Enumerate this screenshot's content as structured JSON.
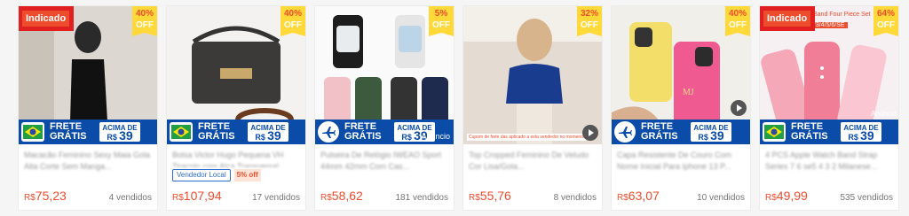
{
  "colors": {
    "accent": "#ee4d2d",
    "frete_bg": "#0a4ca8",
    "discount_bg": "#ffd839"
  },
  "promo": {
    "line1": "FRETE",
    "line2": "GRÁTIS",
    "box_top": "ACIMA DE",
    "box_currency": "R$",
    "box_value": "39"
  },
  "products": [
    {
      "discount": "40%",
      "off": "OFF",
      "badge": "Indicado",
      "title": "Macacão Feminino Sexy Maia Gola Alta Corte Sem Manga...",
      "price_symbol": "R$",
      "price": "75,23",
      "sold": "4 vendidos",
      "icon": "brazil-flag-icon"
    },
    {
      "discount": "40%",
      "off": "OFF",
      "title": "Bolsa Victor Hugo Pequena VH Tiracolo com Alça Transversal...",
      "tag_local": "Vendedor Local",
      "tag_off": "5% off",
      "price_symbol": "R$",
      "price": "107,94",
      "sold": "17 vendidos",
      "icon": "brazil-flag-icon"
    },
    {
      "discount": "5%",
      "off": "OFF",
      "title": "Pulseira De Relógio IWEAO Sport 44mm 42mm Com Cas...",
      "overlay": "Anúncio",
      "price_symbol": "R$",
      "price": "58,62",
      "sold": "181 vendidos",
      "icon": "airplane-icon"
    },
    {
      "discount": "32%",
      "off": "OFF",
      "title": "Top Cropped Feminino De Veludo Cor Lisa/Gola...",
      "overlay": "Cupom de frete das aplicado a esta vendedor no momento",
      "price_symbol": "R$",
      "price": "55,76",
      "sold": "8 vendidos",
      "icon": "none"
    },
    {
      "discount": "40%",
      "off": "OFF",
      "title": "Capa Resistente De Couro Com Nome Inicial Para Iphone 13 P...",
      "price_symbol": "R$",
      "price": "63,07",
      "sold": "10 vendidos",
      "icon": "airplane-icon"
    },
    {
      "discount": "64%",
      "off": "OFF",
      "badge": "Indicado",
      "top_text": "Band Four Piece Set",
      "top_text2": "2/3/4/5/6/SE",
      "overlay": "Anúncio",
      "title": "4 PCS Apple Watch Band Strap Series 7 6 se5 4 3 2 Milanese...",
      "price_symbol": "R$",
      "price": "49,99",
      "sold": "535 vendidos",
      "icon": "brazil-flag-icon"
    }
  ]
}
